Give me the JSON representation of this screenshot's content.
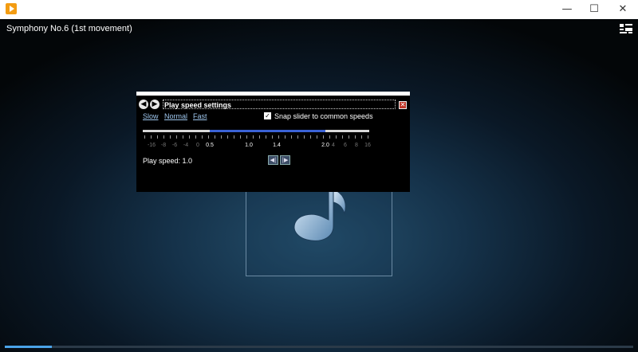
{
  "window": {
    "minimize": "—",
    "maximize": "☐",
    "close": "✕"
  },
  "player": {
    "title": "Symphony No.6 (1st movement)",
    "progress": 0.075
  },
  "dialog": {
    "title": "Play speed settings",
    "back": "◀",
    "forward": "▶",
    "close": "✕",
    "presets": [
      "Slow",
      "Normal",
      "Fast"
    ],
    "snap_checked_glyph": "✓",
    "snap_label": "Snap slider to common speeds",
    "speed_text": "Play speed: 1.0",
    "slower_btn": "◀|",
    "faster_btn": "|▶",
    "ticks": [
      {
        "label": "-16",
        "bright": false
      },
      {
        "label": "-8",
        "bright": false
      },
      {
        "label": "-6",
        "bright": false
      },
      {
        "label": "-4",
        "bright": false
      },
      {
        "label": "0",
        "bright": false
      },
      {
        "label": "0.5",
        "bright": true
      },
      {
        "label": "1.0",
        "bright": true
      },
      {
        "label": "1.4",
        "bright": true
      },
      {
        "label": "2.0",
        "bright": true
      },
      {
        "label": "4",
        "bright": false
      },
      {
        "label": "6",
        "bright": false
      },
      {
        "label": "8",
        "bright": false
      },
      {
        "label": "16",
        "bright": false
      }
    ],
    "speed_range_low": "0.5",
    "speed_range_high": "2.0"
  },
  "colors": {
    "accent": "#3b63d6",
    "progress": "#4aa3e8"
  }
}
